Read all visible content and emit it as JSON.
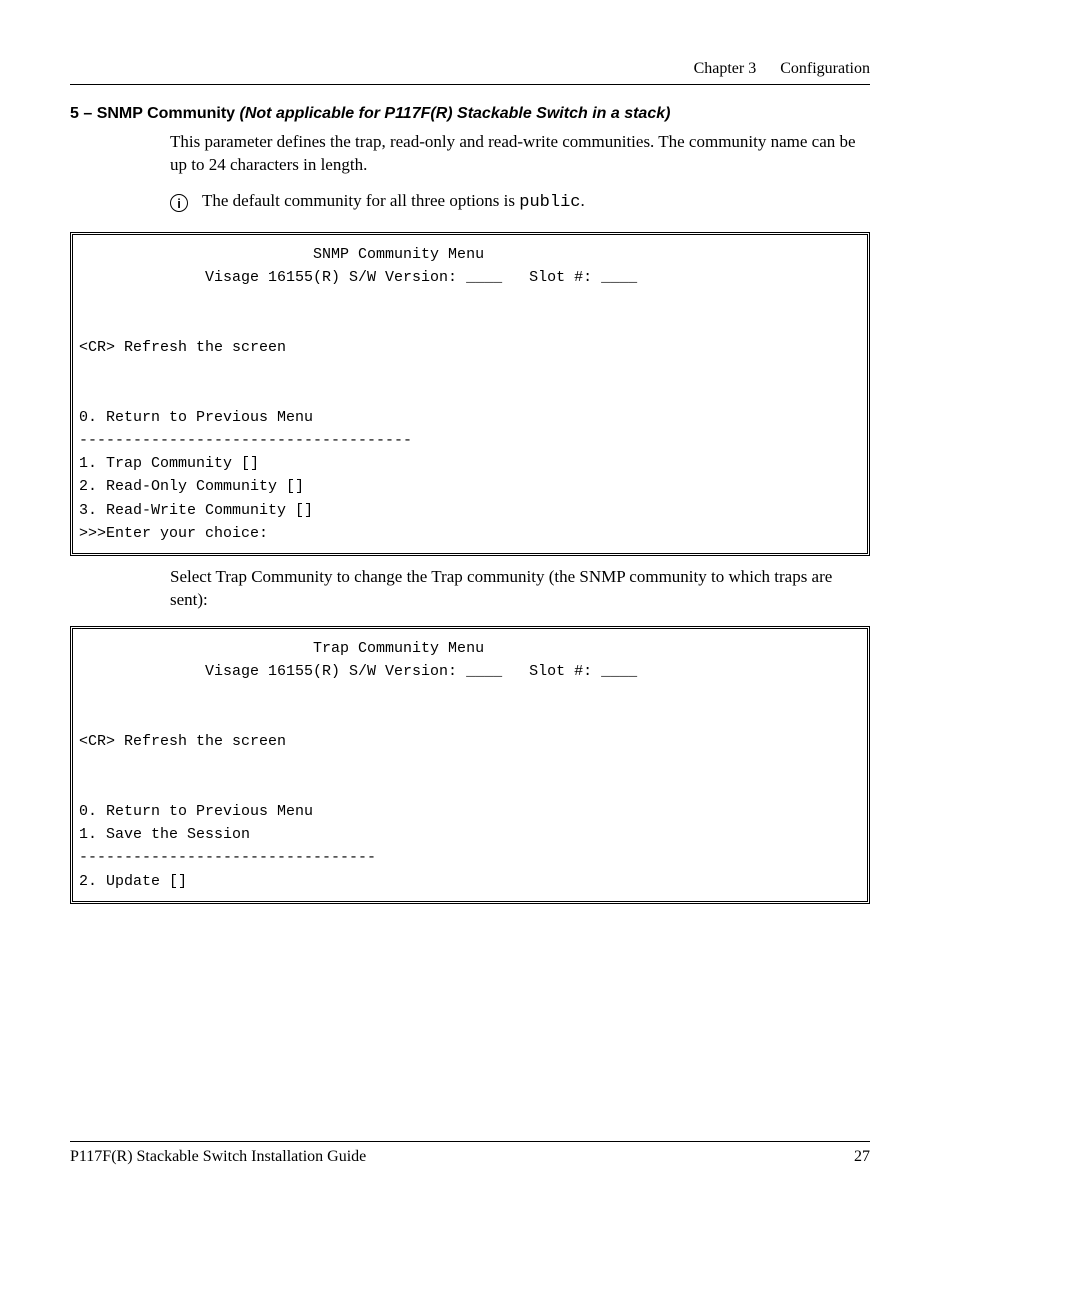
{
  "header": {
    "chapter": "Chapter 3",
    "title": "Configuration"
  },
  "section": {
    "prefix": "5 – SNMP Community ",
    "italic": "(Not applicable for P117F(R) Stackable Switch in a stack)"
  },
  "para1": "This parameter defines the trap, read-only and read-write communities. The community name can be up to 24 characters in length.",
  "info_icon": "i",
  "info_text_before": "The default community for all three options is ",
  "info_mono": "public",
  "info_text_after": ".",
  "terminal1": "                          SNMP Community Menu\n              Visage 16155(R) S/W Version: ____   Slot #: ____\n\n\n<CR> Refresh the screen\n\n\n0. Return to Previous Menu\n-------------------------------------\n1. Trap Community []\n2. Read-Only Community []\n3. Read-Write Community []\n>>>Enter your choice:",
  "para2": "Select Trap Community to change the Trap community (the SNMP community to which traps are sent):",
  "terminal2": "                          Trap Community Menu\n              Visage 16155(R) S/W Version: ____   Slot #: ____\n\n\n<CR> Refresh the screen\n\n\n0. Return to Previous Menu\n1. Save the Session\n---------------------------------\n2. Update []",
  "footer": {
    "title": "P117F(R) Stackable Switch Installation Guide",
    "page": "27"
  }
}
